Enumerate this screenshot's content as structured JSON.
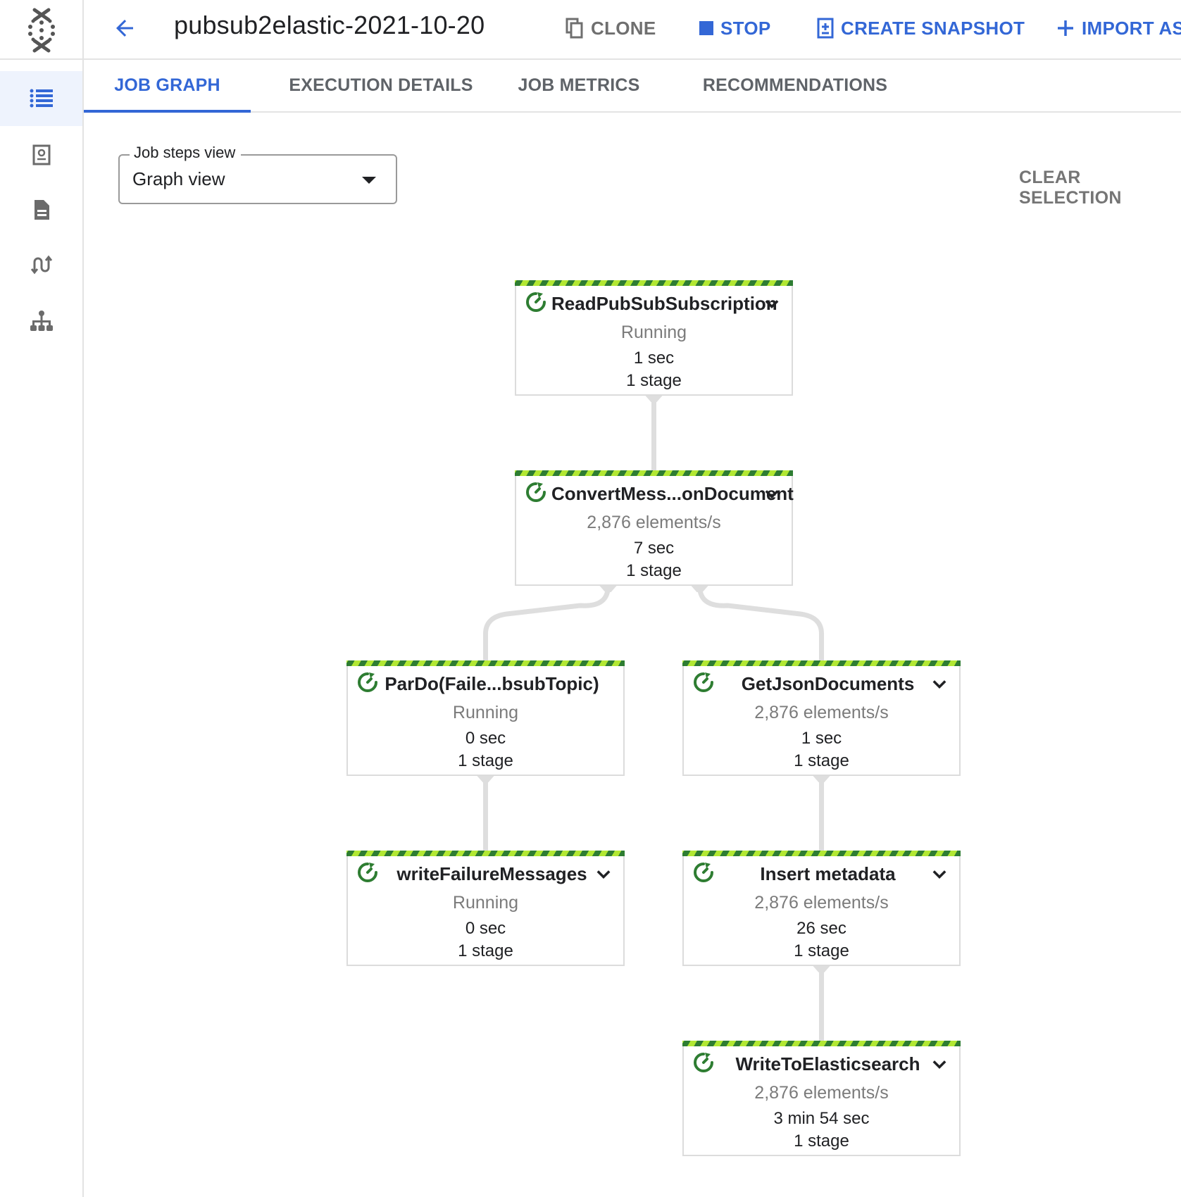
{
  "header": {
    "job_title": "pubsub2elastic-2021-10-20",
    "actions": [
      {
        "label": "CLONE",
        "icon": "clone-icon",
        "color": "#6f6f6f"
      },
      {
        "label": "STOP",
        "icon": "stop-icon",
        "color": "#3367d6"
      },
      {
        "label": "CREATE SNAPSHOT",
        "icon": "snapshot-icon",
        "color": "#3367d6"
      },
      {
        "label": "IMPORT AS",
        "icon": "plus-icon",
        "color": "#3367d6"
      }
    ]
  },
  "sidebar": {
    "items": [
      {
        "icon": "list-icon",
        "active": true
      },
      {
        "icon": "job-info-icon",
        "active": false
      },
      {
        "icon": "document-icon",
        "active": false
      },
      {
        "icon": "swap-arrows-icon",
        "active": false
      },
      {
        "icon": "hierarchy-icon",
        "active": false
      }
    ]
  },
  "tabs": [
    {
      "label": "JOB GRAPH",
      "active": true
    },
    {
      "label": "EXECUTION DETAILS",
      "active": false
    },
    {
      "label": "JOB METRICS",
      "active": false
    },
    {
      "label": "RECOMMENDATIONS",
      "active": false
    }
  ],
  "job_steps_view": {
    "label": "Job steps view",
    "value": "Graph view"
  },
  "clear_selection_label": "CLEAR SELECTION",
  "colors": {
    "accent": "#3367d6",
    "running_green": "#2e7d32",
    "stripe_light": "#b2e833",
    "edge_grey": "#dedede"
  },
  "graph": {
    "nodes": [
      {
        "id": "read",
        "name": "ReadPubSubSubscription",
        "status": "Running",
        "time": "1 sec",
        "stages": "1 stage",
        "expandable": true
      },
      {
        "id": "convert",
        "name": "ConvertMess...onDocument",
        "status": "2,876 elements/s",
        "time": "7 sec",
        "stages": "1 stage",
        "expandable": true
      },
      {
        "id": "pardo",
        "name": "ParDo(Faile...bsubTopic)",
        "status": "Running",
        "time": "0 sec",
        "stages": "1 stage",
        "expandable": false
      },
      {
        "id": "getjson",
        "name": "GetJsonDocuments",
        "status": "2,876 elements/s",
        "time": "1 sec",
        "stages": "1 stage",
        "expandable": true
      },
      {
        "id": "writefail",
        "name": "writeFailureMessages",
        "status": "Running",
        "time": "0 sec",
        "stages": "1 stage",
        "expandable": true
      },
      {
        "id": "insert",
        "name": "Insert metadata",
        "status": "2,876 elements/s",
        "time": "26 sec",
        "stages": "1 stage",
        "expandable": true
      },
      {
        "id": "writees",
        "name": "WriteToElasticsearch",
        "status": "2,876 elements/s",
        "time": "3 min 54 sec",
        "stages": "1 stage",
        "expandable": true
      }
    ],
    "edges": [
      [
        "read",
        "convert"
      ],
      [
        "convert",
        "pardo"
      ],
      [
        "convert",
        "getjson"
      ],
      [
        "pardo",
        "writefail"
      ],
      [
        "getjson",
        "insert"
      ],
      [
        "insert",
        "writees"
      ]
    ]
  }
}
